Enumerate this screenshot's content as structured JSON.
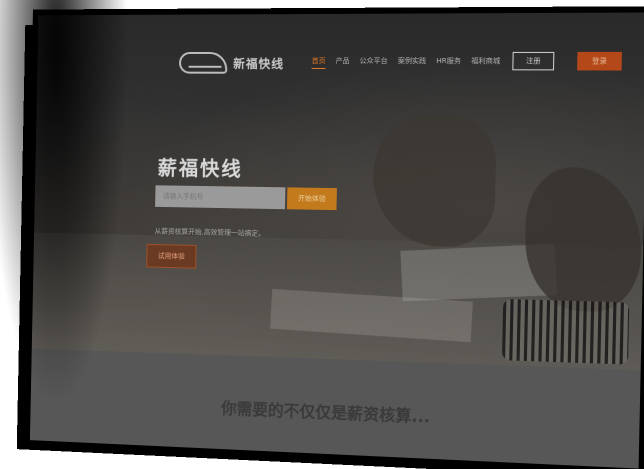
{
  "brand": {
    "logo_text": "新福快线"
  },
  "nav": {
    "items": [
      {
        "label": "首页",
        "active": true
      },
      {
        "label": "产品",
        "active": false
      },
      {
        "label": "公众平台",
        "active": false
      },
      {
        "label": "案例实践",
        "active": false
      },
      {
        "label": "HR服务",
        "active": false
      },
      {
        "label": "福利商城",
        "active": false
      }
    ],
    "register_label": "注册",
    "login_label": "登录"
  },
  "hero": {
    "title": "薪福快线",
    "phone_placeholder": "请输入手机号",
    "start_button_label": "开始体验",
    "slogan": "从薪资核算开始,高效管理一站搞定。",
    "trial_button_label": "试用体验"
  },
  "band": {
    "tagline": "你需要的不仅仅是薪资核算..."
  },
  "colors": {
    "accent": "#e07a2a",
    "login_bg": "#b54818",
    "start_bg": "#c37a1c"
  }
}
